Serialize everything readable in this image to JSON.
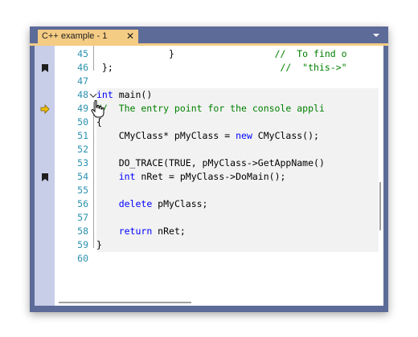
{
  "tab": {
    "title": "C++ example - 1",
    "close_glyph": "✕"
  },
  "lines": [
    {
      "num": "45",
      "code": [
        [
          "t",
          "             }                  "
        ],
        [
          "cm",
          "//  To find o"
        ]
      ],
      "bookmark": false,
      "arrow": false
    },
    {
      "num": "46",
      "code": [
        [
          "t",
          " };                              "
        ],
        [
          "cm",
          "//  \"this->\""
        ]
      ],
      "bookmark": true,
      "arrow": false
    },
    {
      "num": "47",
      "code": [],
      "bookmark": false,
      "arrow": false
    },
    {
      "num": "48",
      "code": [
        [
          "kw",
          "int"
        ],
        [
          "t",
          " main()"
        ]
      ],
      "bookmark": false,
      "arrow": false
    },
    {
      "num": "49",
      "code": [
        [
          "cm",
          "//  The entry point for the console appli"
        ]
      ],
      "bookmark": false,
      "arrow": true
    },
    {
      "num": "50",
      "code": [
        [
          "t",
          "{"
        ]
      ],
      "bookmark": false,
      "arrow": false
    },
    {
      "num": "51",
      "code": [
        [
          "t",
          "    CMyClass* pMyClass = "
        ],
        [
          "kw",
          "new"
        ],
        [
          "t",
          " CMyClass();"
        ]
      ],
      "bookmark": false,
      "arrow": false
    },
    {
      "num": "52",
      "code": [],
      "bookmark": false,
      "arrow": false
    },
    {
      "num": "53",
      "code": [
        [
          "t",
          "    DO_TRACE(TRUE, pMyClass->GetAppName()"
        ]
      ],
      "bookmark": false,
      "arrow": false
    },
    {
      "num": "54",
      "code": [
        [
          "t",
          "    "
        ],
        [
          "kw",
          "int"
        ],
        [
          "t",
          " nRet = pMyClass->DoMain();"
        ]
      ],
      "bookmark": true,
      "arrow": false
    },
    {
      "num": "55",
      "code": [],
      "bookmark": false,
      "arrow": false
    },
    {
      "num": "56",
      "code": [
        [
          "t",
          "    "
        ],
        [
          "kw",
          "delete"
        ],
        [
          "t",
          " pMyClass;"
        ]
      ],
      "bookmark": false,
      "arrow": false
    },
    {
      "num": "57",
      "code": [],
      "bookmark": false,
      "arrow": false
    },
    {
      "num": "58",
      "code": [
        [
          "t",
          "    "
        ],
        [
          "kw",
          "return"
        ],
        [
          "t",
          " nRet;"
        ]
      ],
      "bookmark": false,
      "arrow": false
    },
    {
      "num": "59",
      "code": [
        [
          "t",
          "}"
        ]
      ],
      "bookmark": false,
      "arrow": false
    },
    {
      "num": "60",
      "code": [],
      "bookmark": false,
      "arrow": false
    }
  ],
  "colors": {
    "keyword": "#0000ff",
    "comment": "#008000",
    "line_number": "#2b91af",
    "tab_active": "#f5cc84",
    "frame": "#5d6b99",
    "margin": "#c8cde8",
    "current_line_arrow": "#f0c000"
  },
  "icons": {
    "bookmark": "bookmark-icon",
    "execution_arrow": "execution-pointer-icon",
    "collapse": "collapse-chevron-icon",
    "dropdown": "tab-dropdown-icon"
  }
}
